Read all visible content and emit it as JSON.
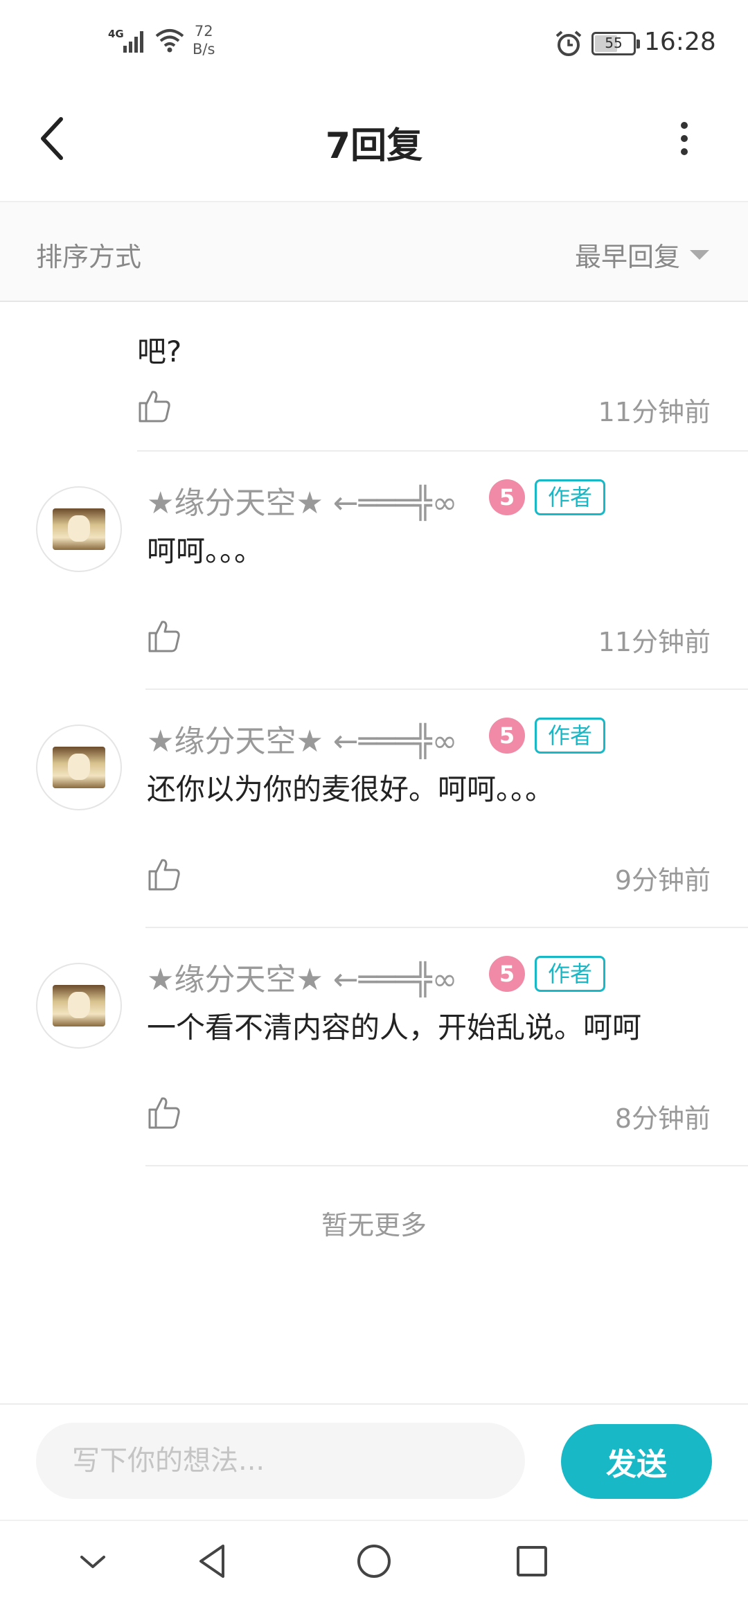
{
  "status_bar": {
    "network": "4G",
    "speed_value": "72",
    "speed_unit": "B/s",
    "battery": "55",
    "time": "16:28"
  },
  "header": {
    "title": "7回复"
  },
  "sort": {
    "label": "排序方式",
    "value": "最早回复"
  },
  "partial_comment": {
    "text_line2": "吧?",
    "time": "11分钟前"
  },
  "comments": [
    {
      "username": "★缘分天空★ ←═══╬∞",
      "level": "5",
      "tag": "作者",
      "content": "呵呵。。。",
      "time": "11分钟前"
    },
    {
      "username": "★缘分天空★ ←═══╬∞",
      "level": "5",
      "tag": "作者",
      "content": "还你以为你的麦很好。呵呵。。。",
      "time": "9分钟前"
    },
    {
      "username": "★缘分天空★ ←═══╬∞",
      "level": "5",
      "tag": "作者",
      "content": "一个看不清内容的人，开始乱说。呵呵",
      "time": "8分钟前"
    }
  ],
  "no_more_text": "暂无更多",
  "input": {
    "placeholder": "写下你的想法...",
    "send_label": "发送"
  },
  "colors": {
    "accent": "#19b8c6",
    "level_badge": "#f08aa6"
  }
}
